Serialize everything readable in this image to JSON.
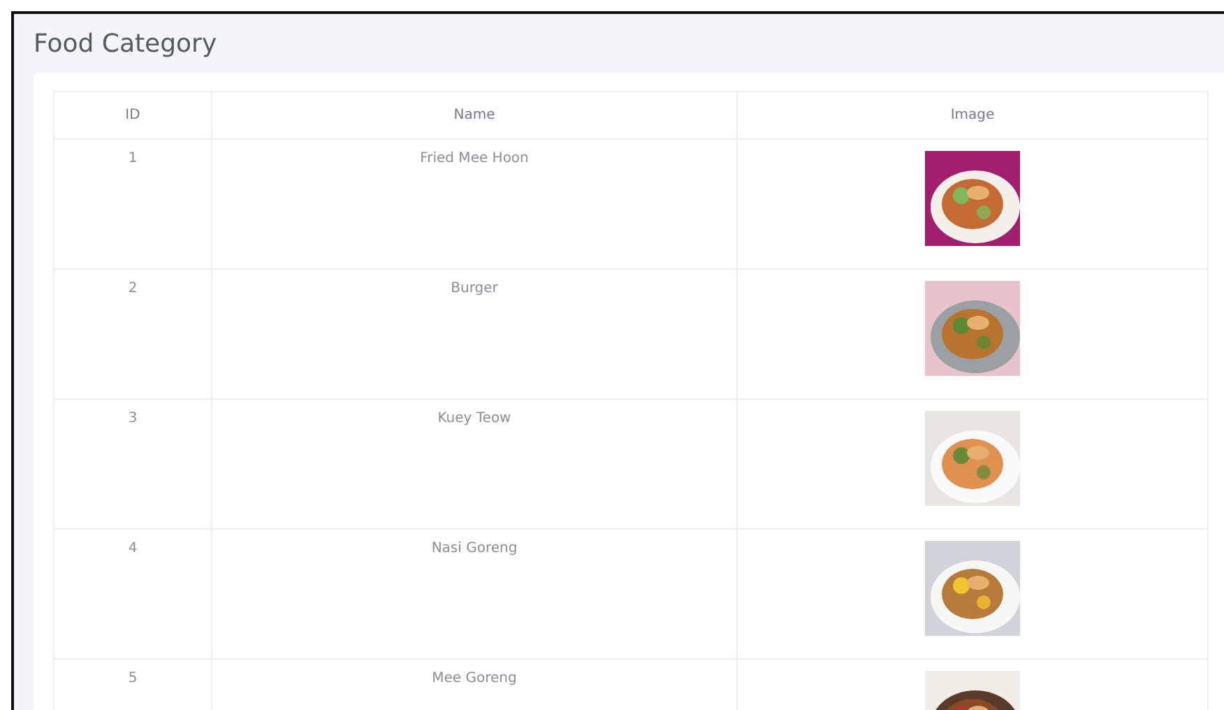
{
  "page": {
    "title": "Food Category"
  },
  "table": {
    "columns": [
      "ID",
      "Name",
      "Image"
    ],
    "rows": [
      {
        "id": "1",
        "name": "Fried Mee Hoon"
      },
      {
        "id": "2",
        "name": "Burger"
      },
      {
        "id": "3",
        "name": "Kuey Teow"
      },
      {
        "id": "4",
        "name": "Nasi Goreng"
      },
      {
        "id": "5",
        "name": "Mee Goreng"
      }
    ]
  }
}
